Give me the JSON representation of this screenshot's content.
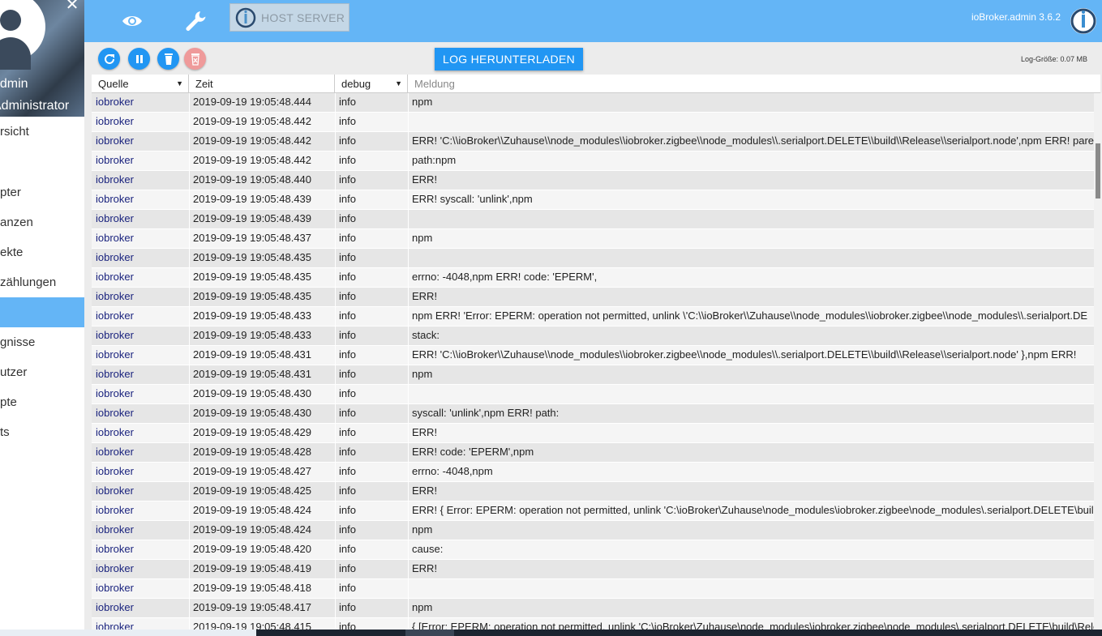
{
  "sidebar": {
    "user_name": "admin",
    "user_role": "Administrator",
    "items": [
      {
        "label": "Übersicht",
        "visible": "rsicht"
      },
      {
        "label": "",
        "visible": ""
      },
      {
        "label": "Adapter",
        "visible": "pter"
      },
      {
        "label": "Instanzen",
        "visible": "anzen"
      },
      {
        "label": "Objekte",
        "visible": "ekte"
      },
      {
        "label": "Aufzählungen",
        "visible": "zählungen"
      },
      {
        "label": "",
        "visible": ""
      },
      {
        "label": "Ereignisse",
        "visible": "gnisse"
      },
      {
        "label": "Benutzer",
        "visible": "utzer"
      },
      {
        "label": "Skripte",
        "visible": "pte"
      },
      {
        "label": "Hosts",
        "visible": "ts"
      }
    ]
  },
  "topbar": {
    "host_server_label": "HOST SERVER",
    "version": "ioBroker.admin 3.6.2"
  },
  "toolbar": {
    "download_label": "LOG HERUNTERLADEN",
    "log_size": "Log-Größe: 0.07 MB"
  },
  "table": {
    "columns": {
      "source": "Quelle",
      "time": "Zeit",
      "severity": "debug",
      "message": "Meldung"
    },
    "rows": [
      {
        "src": "iobroker",
        "time": "2019-09-19 19:05:48.444",
        "sev": "info",
        "msg": "npm"
      },
      {
        "src": "iobroker",
        "time": "2019-09-19 19:05:48.442",
        "sev": "info",
        "msg": ""
      },
      {
        "src": "iobroker",
        "time": "2019-09-19 19:05:48.442",
        "sev": "info",
        "msg": "ERR! 'C:\\\\ioBroker\\\\Zuhause\\\\node_modules\\\\iobroker.zigbee\\\\node_modules\\\\.serialport.DELETE\\\\build\\\\Release\\\\serialport.node',npm ERR! pare"
      },
      {
        "src": "iobroker",
        "time": "2019-09-19 19:05:48.442",
        "sev": "info",
        "msg": "path:npm"
      },
      {
        "src": "iobroker",
        "time": "2019-09-19 19:05:48.440",
        "sev": "info",
        "msg": "ERR!"
      },
      {
        "src": "iobroker",
        "time": "2019-09-19 19:05:48.439",
        "sev": "info",
        "msg": "ERR! syscall: 'unlink',npm"
      },
      {
        "src": "iobroker",
        "time": "2019-09-19 19:05:48.439",
        "sev": "info",
        "msg": ""
      },
      {
        "src": "iobroker",
        "time": "2019-09-19 19:05:48.437",
        "sev": "info",
        "msg": "npm"
      },
      {
        "src": "iobroker",
        "time": "2019-09-19 19:05:48.435",
        "sev": "info",
        "msg": ""
      },
      {
        "src": "iobroker",
        "time": "2019-09-19 19:05:48.435",
        "sev": "info",
        "msg": "errno: -4048,npm ERR! code: 'EPERM',"
      },
      {
        "src": "iobroker",
        "time": "2019-09-19 19:05:48.435",
        "sev": "info",
        "msg": "ERR!"
      },
      {
        "src": "iobroker",
        "time": "2019-09-19 19:05:48.433",
        "sev": "info",
        "msg": "npm ERR! 'Error: EPERM: operation not permitted, unlink \\'C:\\\\ioBroker\\\\Zuhause\\\\node_modules\\\\iobroker.zigbee\\\\node_modules\\\\.serialport.DE"
      },
      {
        "src": "iobroker",
        "time": "2019-09-19 19:05:48.433",
        "sev": "info",
        "msg": "stack:"
      },
      {
        "src": "iobroker",
        "time": "2019-09-19 19:05:48.431",
        "sev": "info",
        "msg": "ERR! 'C:\\\\ioBroker\\\\Zuhause\\\\node_modules\\\\iobroker.zigbee\\\\node_modules\\\\.serialport.DELETE\\\\build\\\\Release\\\\serialport.node' },npm ERR!"
      },
      {
        "src": "iobroker",
        "time": "2019-09-19 19:05:48.431",
        "sev": "info",
        "msg": "npm"
      },
      {
        "src": "iobroker",
        "time": "2019-09-19 19:05:48.430",
        "sev": "info",
        "msg": ""
      },
      {
        "src": "iobroker",
        "time": "2019-09-19 19:05:48.430",
        "sev": "info",
        "msg": "syscall: 'unlink',npm ERR! path:"
      },
      {
        "src": "iobroker",
        "time": "2019-09-19 19:05:48.429",
        "sev": "info",
        "msg": "ERR!"
      },
      {
        "src": "iobroker",
        "time": "2019-09-19 19:05:48.428",
        "sev": "info",
        "msg": "ERR! code: 'EPERM',npm"
      },
      {
        "src": "iobroker",
        "time": "2019-09-19 19:05:48.427",
        "sev": "info",
        "msg": "errno: -4048,npm"
      },
      {
        "src": "iobroker",
        "time": "2019-09-19 19:05:48.425",
        "sev": "info",
        "msg": "ERR!"
      },
      {
        "src": "iobroker",
        "time": "2019-09-19 19:05:48.424",
        "sev": "info",
        "msg": "ERR! { Error: EPERM: operation not permitted, unlink 'C:\\ioBroker\\Zuhause\\node_modules\\iobroker.zigbee\\node_modules\\.serialport.DELETE\\build"
      },
      {
        "src": "iobroker",
        "time": "2019-09-19 19:05:48.424",
        "sev": "info",
        "msg": "npm"
      },
      {
        "src": "iobroker",
        "time": "2019-09-19 19:05:48.420",
        "sev": "info",
        "msg": "cause:"
      },
      {
        "src": "iobroker",
        "time": "2019-09-19 19:05:48.419",
        "sev": "info",
        "msg": "ERR!"
      },
      {
        "src": "iobroker",
        "time": "2019-09-19 19:05:48.418",
        "sev": "info",
        "msg": ""
      },
      {
        "src": "iobroker",
        "time": "2019-09-19 19:05:48.417",
        "sev": "info",
        "msg": "npm"
      },
      {
        "src": "iobroker",
        "time": "2019-09-19 19:05:48.415",
        "sev": "info",
        "msg": "{ [Error: EPERM: operation not permitted, unlink 'C:\\ioBroker\\Zuhause\\node_modules\\iobroker.zigbee\\node_modules\\.serialport.DELETE\\build\\Rele"
      }
    ]
  },
  "colors": {
    "topbar": "#64b5f6",
    "button": "#2196f3",
    "active_menu": "#64b5f6",
    "danger_button": "#ef9a9a",
    "source_text": "#1a237e"
  }
}
